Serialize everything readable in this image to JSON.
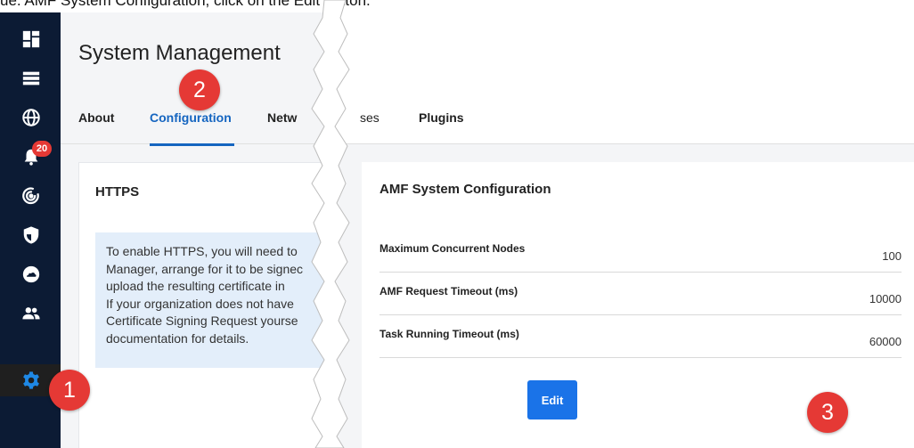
{
  "caption": "ue. AMF System Configuration, click on the Edit button.",
  "sidebar": {
    "items": [
      {
        "icon": "dashboard-icon"
      },
      {
        "icon": "list-icon"
      },
      {
        "icon": "globe-icon"
      },
      {
        "icon": "alarm-bell-icon",
        "badge": "20"
      },
      {
        "icon": "radar-icon"
      },
      {
        "icon": "shield-icon"
      },
      {
        "icon": "cloud-icon"
      },
      {
        "icon": "users-icon"
      },
      {
        "icon": "gear-icon",
        "active": true
      }
    ]
  },
  "page": {
    "title": "System Management"
  },
  "tabs": [
    {
      "label": "About"
    },
    {
      "label": "Configuration",
      "active": true
    },
    {
      "label": "Netw"
    },
    {
      "label": "ses"
    },
    {
      "label": "Plugins"
    }
  ],
  "https_card": {
    "title": "HTTPS",
    "info_lines": [
      "To enable HTTPS, you will need to",
      "Manager, arrange for it to be signec",
      "upload the resulting certificate in",
      "If your organization does not have",
      "Certificate Signing Request yourse",
      "documentation for details."
    ]
  },
  "amf_card": {
    "title": "AMF System Configuration",
    "rows": [
      {
        "label": "Maximum Concurrent Nodes",
        "value": "100"
      },
      {
        "label": "AMF Request Timeout (ms)",
        "value": "10000"
      },
      {
        "label": "Task Running Timeout (ms)",
        "value": "60000"
      }
    ],
    "edit_label": "Edit"
  },
  "steps": [
    "1",
    "2",
    "3"
  ],
  "colors": {
    "sidebar": "#0c1b34",
    "accent": "#1565c0",
    "button": "#1a73e8",
    "step_marker": "#e53935",
    "info_box": "#e3eefa"
  }
}
